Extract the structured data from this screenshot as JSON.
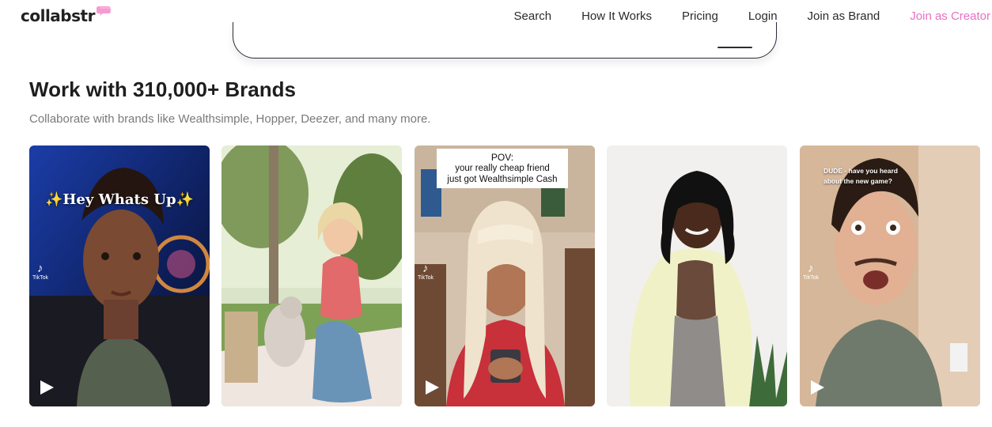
{
  "nav": {
    "logo_text": "collabstr",
    "links": [
      {
        "label": "Search"
      },
      {
        "label": "How It Works"
      },
      {
        "label": "Pricing"
      },
      {
        "label": "Login"
      },
      {
        "label": "Join as Brand"
      },
      {
        "label": "Join as Creator"
      }
    ],
    "creator_color": "#e86fc3"
  },
  "section": {
    "title": "Work with 310,000+ Brands",
    "subtitle": "Collaborate with brands like Wealthsimple, Hopper, Deezer, and many more."
  },
  "cards": [
    {
      "overlay": "✨Hey Whats Up✨",
      "platform": "TikTok",
      "has_play": true
    },
    {
      "overlay": "",
      "platform": "",
      "has_play": false
    },
    {
      "overlay_title": "POV:",
      "overlay_lines": [
        "your really cheap friend",
        "just got Wealthsimple Cash"
      ],
      "platform": "TikTok",
      "has_play": true
    },
    {
      "overlay": "",
      "platform": "",
      "has_play": false
    },
    {
      "overlay": "DUDE - have you heard about the new game?",
      "platform": "TikTok",
      "has_play": true
    }
  ],
  "icons": {
    "logo_bubble": "speech-bubble-icon",
    "tiktok": "tiktok-icon",
    "play": "play-icon"
  }
}
